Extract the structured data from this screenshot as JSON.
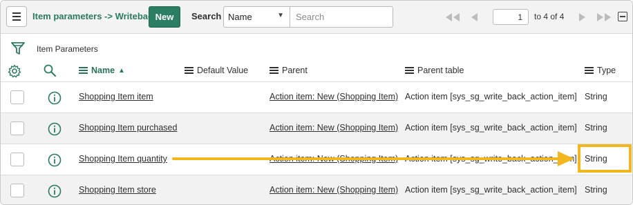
{
  "header": {
    "breadcrumb": "Item parameters -> Writeback",
    "new_label": "New",
    "search_label": "Search",
    "search_field_selected": "Name",
    "search_placeholder": "Search",
    "page_number": "1",
    "page_of": "to 4 of 4"
  },
  "list": {
    "title": "Item Parameters",
    "columns": [
      {
        "label": "Name",
        "sorted": "ascending"
      },
      {
        "label": "Default Value"
      },
      {
        "label": "Parent"
      },
      {
        "label": "Parent table"
      },
      {
        "label": "Type"
      }
    ],
    "rows": [
      {
        "name": "Shopping Item item",
        "default_value": "",
        "parent": "Action item: New (Shopping Item)",
        "parent_table": "Action item [sys_sg_write_back_action_item]",
        "type": "String"
      },
      {
        "name": "Shopping Item purchased",
        "default_value": "",
        "parent": "Action item: New (Shopping Item)",
        "parent_table": "Action item [sys_sg_write_back_action_item]",
        "type": "String"
      },
      {
        "name": "Shopping Item quantity",
        "default_value": "",
        "parent": "Action item: New (Shopping Item)",
        "parent_table": "Action item [sys_sg_write_back_action_item]",
        "type": "String"
      },
      {
        "name": "Shopping Item store",
        "default_value": "",
        "parent": "Action item: New (Shopping Item)",
        "parent_table": "Action item [sys_sg_write_back_action_item]",
        "type": "String"
      }
    ]
  },
  "icons": {
    "menu": "hamburger-icon",
    "pager_first": "double-chevron-left-icon",
    "pager_prev": "chevron-left-icon",
    "pager_next": "chevron-right-icon",
    "pager_last": "double-chevron-right-icon",
    "collapse": "collapse-icon",
    "filter": "funnel-icon",
    "personalize": "gear-icon",
    "column_search": "search-icon",
    "row_preview": "info-icon"
  },
  "colors": {
    "accent": "#2b7d64",
    "annotation": "#f2b71f"
  }
}
